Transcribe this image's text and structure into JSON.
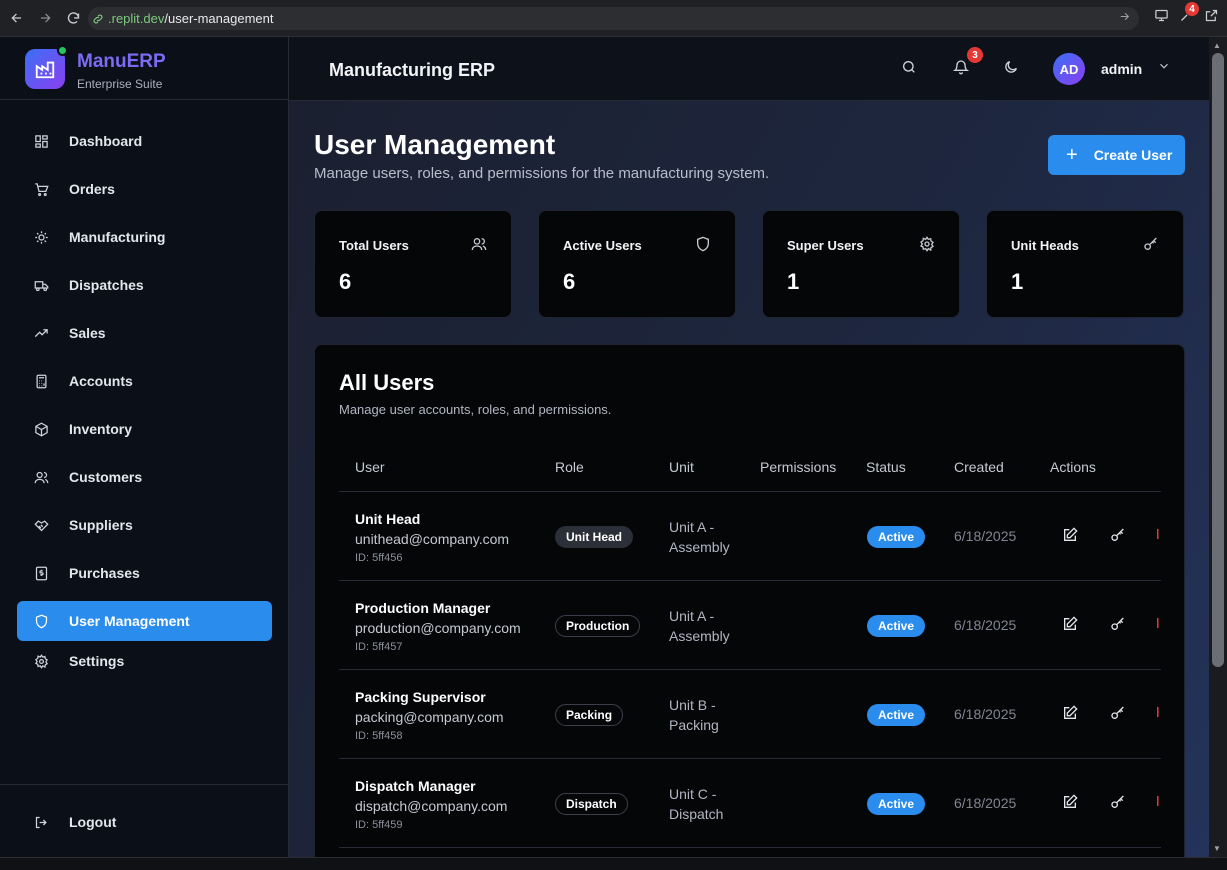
{
  "browser": {
    "url_domain": ".replit.dev",
    "url_path": "/user-management",
    "extension_badge": "4"
  },
  "brand": {
    "name": "ManuERP",
    "subtitle": "Enterprise Suite"
  },
  "sidebar": {
    "items": [
      {
        "label": "Dashboard",
        "icon": "dashboard-icon"
      },
      {
        "label": "Orders",
        "icon": "cart-icon"
      },
      {
        "label": "Manufacturing",
        "icon": "cog-icon"
      },
      {
        "label": "Dispatches",
        "icon": "truck-icon"
      },
      {
        "label": "Sales",
        "icon": "trending-up-icon"
      },
      {
        "label": "Accounts",
        "icon": "calculator-icon"
      },
      {
        "label": "Inventory",
        "icon": "box-icon"
      },
      {
        "label": "Customers",
        "icon": "users-icon"
      },
      {
        "label": "Suppliers",
        "icon": "handshake-icon"
      },
      {
        "label": "Purchases",
        "icon": "receipt-icon"
      },
      {
        "label": "User Management",
        "icon": "shield-icon",
        "active": true
      },
      {
        "label": "Settings",
        "icon": "gear-icon"
      }
    ],
    "logout_label": "Logout"
  },
  "header": {
    "title": "Manufacturing ERP",
    "notification_count": "3",
    "avatar_initials": "AD",
    "user_name": "admin"
  },
  "page": {
    "title": "User Management",
    "subtitle": "Manage users, roles, and permissions for the manufacturing system.",
    "create_button": "Create User"
  },
  "stats": [
    {
      "label": "Total Users",
      "value": "6",
      "icon": "users-icon"
    },
    {
      "label": "Active Users",
      "value": "6",
      "icon": "shield-icon"
    },
    {
      "label": "Super Users",
      "value": "1",
      "icon": "gear-icon"
    },
    {
      "label": "Unit Heads",
      "value": "1",
      "icon": "key-icon"
    }
  ],
  "users_table": {
    "title": "All Users",
    "subtitle": "Manage user accounts, roles, and permissions.",
    "columns": [
      "User",
      "Role",
      "Unit",
      "Permissions",
      "Status",
      "Created",
      "Actions"
    ],
    "rows": [
      {
        "name": "Unit Head",
        "email": "unithead@company.com",
        "id": "ID: 5ff456",
        "role": "Unit Head",
        "role_style": "filled",
        "unit": "Unit A - Assembly",
        "status": "Active",
        "created": "6/18/2025"
      },
      {
        "name": "Production Manager",
        "email": "production@company.com",
        "id": "ID: 5ff457",
        "role": "Production",
        "role_style": "outline",
        "unit": "Unit A - Assembly",
        "status": "Active",
        "created": "6/18/2025"
      },
      {
        "name": "Packing Supervisor",
        "email": "packing@company.com",
        "id": "ID: 5ff458",
        "role": "Packing",
        "role_style": "outline",
        "unit": "Unit B - Packing",
        "status": "Active",
        "created": "6/18/2025"
      },
      {
        "name": "Dispatch Manager",
        "email": "dispatch@company.com",
        "id": "ID: 5ff459",
        "role": "Dispatch",
        "role_style": "outline",
        "unit": "Unit C - Dispatch",
        "status": "Active",
        "created": "6/18/2025"
      }
    ]
  },
  "colors": {
    "accent": "#2a8cec",
    "danger": "#e53935",
    "sidebar_bg": "#0b0f18",
    "card_bg": "#050608"
  }
}
